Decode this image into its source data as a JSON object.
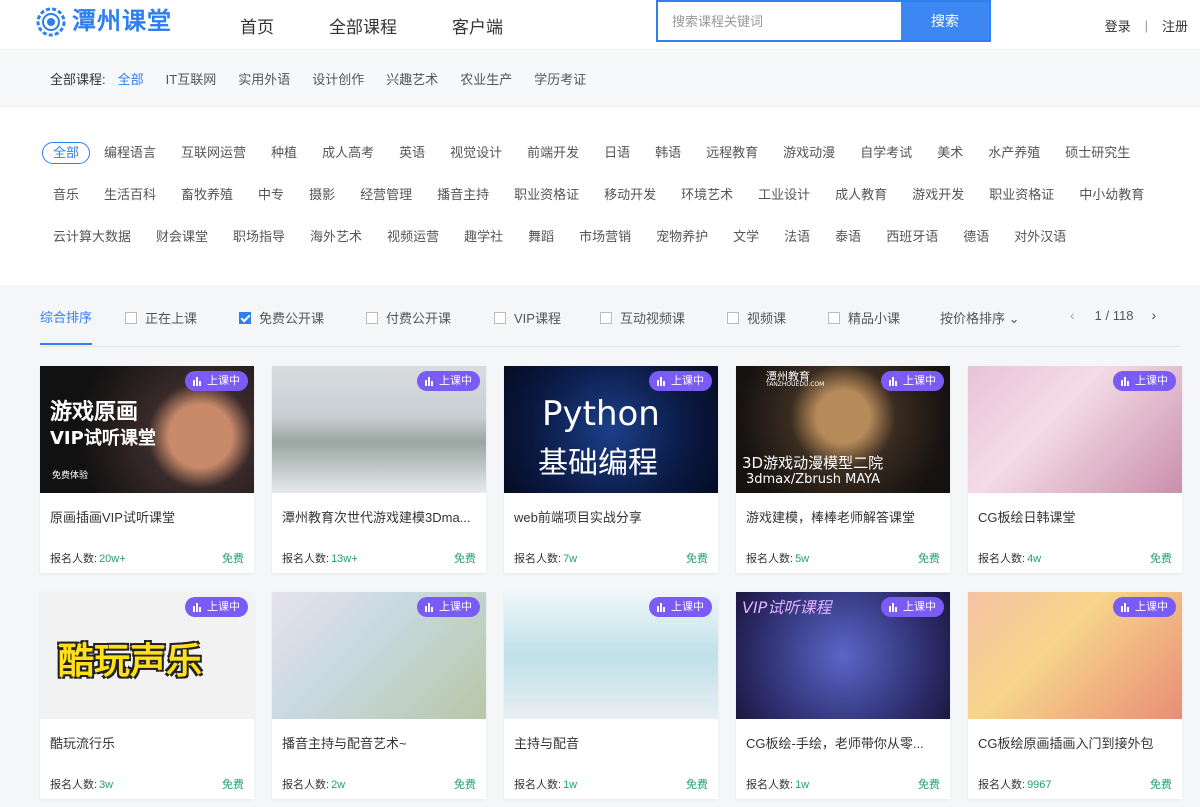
{
  "brand": {
    "name": "潭州课堂"
  },
  "nav": [
    "首页",
    "全部课程",
    "客户端"
  ],
  "search": {
    "placeholder": "搜索课程关键词",
    "button": "搜索"
  },
  "auth": {
    "login": "登录",
    "separator": "|",
    "register": "注册"
  },
  "category_bar": {
    "label": "全部课程:",
    "items": [
      "全部",
      "IT互联网",
      "实用外语",
      "设计创作",
      "兴趣艺术",
      "农业生产",
      "学历考证"
    ],
    "active_index": 0
  },
  "tags": {
    "items": [
      "全部",
      "编程语言",
      "互联网运营",
      "种植",
      "成人高考",
      "英语",
      "视觉设计",
      "前端开发",
      "日语",
      "韩语",
      "远程教育",
      "游戏动漫",
      "自学考试",
      "美术",
      "水产养殖",
      "硕士研究生",
      "音乐",
      "生活百科",
      "畜牧养殖",
      "中专",
      "摄影",
      "经营管理",
      "播音主持",
      "职业资格证",
      "移动开发",
      "环境艺术",
      "工业设计",
      "成人教育",
      "游戏开发",
      "职业资格证",
      "中小幼教育",
      "云计算大数据",
      "财会课堂",
      "职场指导",
      "海外艺术",
      "视频运营",
      "趣学社",
      "舞蹈",
      "市场营销",
      "宠物养护",
      "文学",
      "法语",
      "泰语",
      "西班牙语",
      "德语",
      "对外汉语"
    ],
    "active_index": 0
  },
  "filters": {
    "sort_tab": "综合排序",
    "checkboxes": [
      {
        "label": "正在上课",
        "checked": false
      },
      {
        "label": "免费公开课",
        "checked": true
      },
      {
        "label": "付费公开课",
        "checked": false
      },
      {
        "label": "VIP课程",
        "checked": false
      },
      {
        "label": "互动视频课",
        "checked": false
      },
      {
        "label": "视频课",
        "checked": false
      },
      {
        "label": "精品小课",
        "checked": false
      }
    ],
    "price_sort": "按价格排序",
    "pager": {
      "current": "1",
      "total": "118",
      "text": "1 / 118"
    }
  },
  "card_labels": {
    "badge": "上课中",
    "enroll": "报名人数:",
    "price": "免费"
  },
  "courses": [
    {
      "title": "原画插画VIP试听课堂",
      "count": "20w+",
      "thumb_texts": [
        "游戏原画",
        "VIP试听课堂",
        "免费体验"
      ]
    },
    {
      "title": "潭州教育次世代游戏建模3Dma...",
      "count": "13w+",
      "thumb_texts": []
    },
    {
      "title": "web前端项目实战分享",
      "count": "7w",
      "thumb_texts": [
        "Python",
        "基础编程"
      ]
    },
    {
      "title": "游戏建模，棒棒老师解答课堂",
      "count": "5w",
      "thumb_texts": [
        "潭州教育",
        "TANZHOUEDU.COM",
        "3D游戏动漫模型二院",
        "3dmax/Zbrush MAYA"
      ]
    },
    {
      "title": "CG板绘日韩课堂",
      "count": "4w",
      "thumb_texts": []
    },
    {
      "title": "酷玩流行乐",
      "count": "3w",
      "thumb_texts": [
        "酷玩声乐"
      ]
    },
    {
      "title": "播音主持与配音艺术~",
      "count": "2w",
      "thumb_texts": []
    },
    {
      "title": "主持与配音",
      "count": "1w",
      "thumb_texts": []
    },
    {
      "title": "CG板绘-手绘，老师带你从零...",
      "count": "1w",
      "thumb_texts": [
        "VIP试听课程"
      ]
    },
    {
      "title": "CG板绘原画插画入门到接外包",
      "count": "9967",
      "thumb_texts": []
    }
  ],
  "colors": {
    "accent": "#2e7ff0",
    "badge": "#7a5cf5",
    "free": "#27a06b"
  }
}
